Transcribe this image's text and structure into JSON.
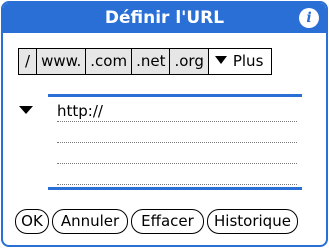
{
  "dialog": {
    "title": "Définir l'URL",
    "info_icon": "info-icon",
    "accent_color": "#2a6fd6"
  },
  "shortcuts": {
    "items": [
      "/",
      "www.",
      ".com",
      ".net",
      ".org"
    ],
    "more_label": "Plus"
  },
  "url_field": {
    "value": "http://"
  },
  "buttons": {
    "ok": "OK",
    "cancel": "Annuler",
    "clear": "Effacer",
    "history": "Historique"
  }
}
